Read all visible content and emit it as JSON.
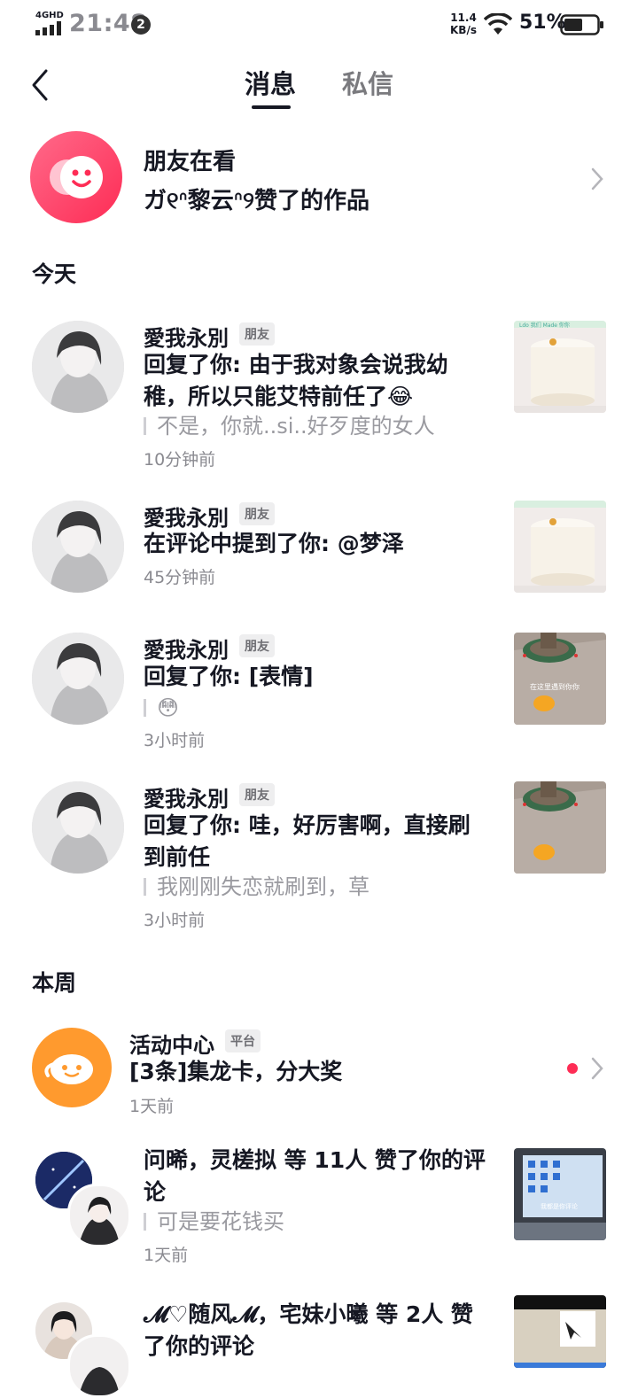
{
  "status_bar": {
    "network": "4GHD",
    "time": "21:48",
    "notification_count": "2",
    "speed_value": "11.4",
    "speed_unit": "KB/s",
    "battery": "51%"
  },
  "header": {
    "tabs": [
      {
        "label": "消息",
        "active": true
      },
      {
        "label": "私信",
        "active": false
      }
    ]
  },
  "friends_watching": {
    "title": "朋友在看",
    "subtitle": "ガ୧ᐢ黎云ᐢ୨赞了的作品"
  },
  "sections": {
    "today": "今天",
    "this_week": "本周"
  },
  "today_items": [
    {
      "name": "愛我永別",
      "tag": "朋友",
      "content": "回复了你: 由于我对象会说我幼稚，所以只能艾特前任了😂",
      "quote": "不是，你就..si..好歹度的女人",
      "time": "10分钟前"
    },
    {
      "name": "愛我永別",
      "tag": "朋友",
      "content": "在评论中提到了你: @梦泽",
      "quote": "",
      "time": "45分钟前"
    },
    {
      "name": "愛我永別",
      "tag": "朋友",
      "content": "回复了你: [表情]",
      "quote": "😳",
      "time": "3小时前"
    },
    {
      "name": "愛我永別",
      "tag": "朋友",
      "content": "回复了你: 哇，好厉害啊，直接刷到前任",
      "quote": "我刚刚失恋就刷到，草",
      "time": "3小时前"
    }
  ],
  "week_items": [
    {
      "name": "活动中心",
      "tag": "平台",
      "content": "[3条]集龙卡，分大奖",
      "time": "1天前"
    },
    {
      "content": "问晞，灵槎拟 等 11人 赞了你的评论",
      "quote": "可是要花钱买",
      "time": "1天前"
    },
    {
      "content": "𝓜♡随风𝓜，宅妹小曦 等 2人 赞了你的评论",
      "quote": "",
      "time": ""
    }
  ],
  "thumb_captions": {
    "cake": "Ldo 我们 Made 你你",
    "park": "在这里遇到你你",
    "screen": "我都是你评论"
  },
  "colors": {
    "accent": "#fe2c55",
    "activity": "#ff9a2e",
    "text_primary": "#161823",
    "text_secondary": "#8a8a90"
  }
}
